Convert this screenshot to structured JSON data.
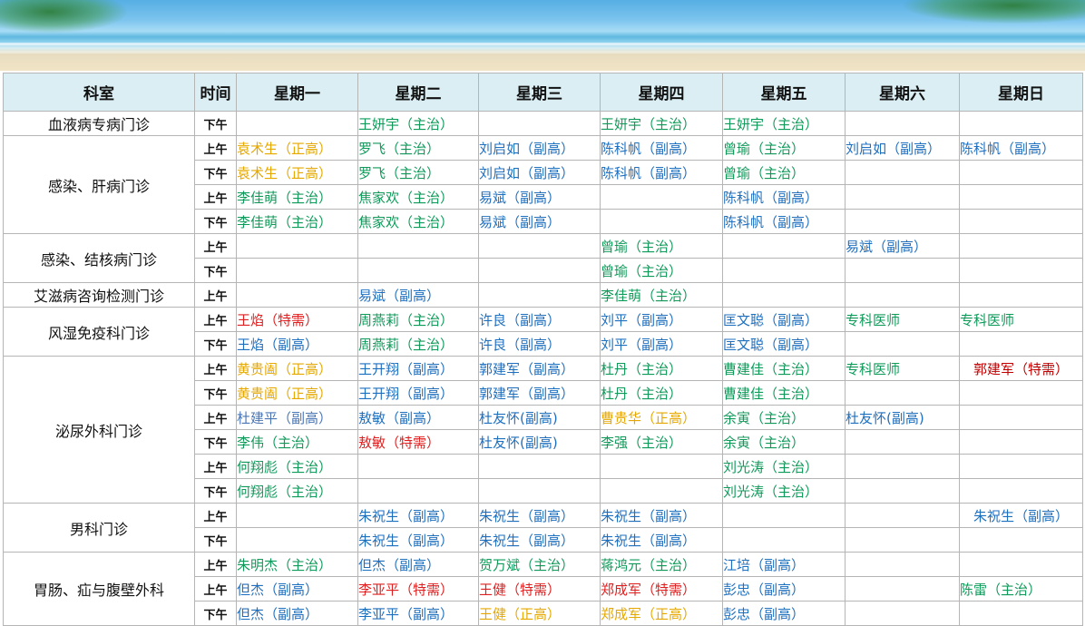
{
  "colors": {
    "blue": "#1f6fbf",
    "green": "#0f9a5a",
    "orange": "#e6a800",
    "red": "#e02020",
    "darkred": "#c00000",
    "steel": "#4a76b5",
    "header_bg": "#daeef3"
  },
  "header": [
    "科室",
    "时间",
    "星期一",
    "星期二",
    "星期三",
    "星期四",
    "星期五",
    "星期六",
    "星期日"
  ],
  "departments": [
    {
      "name": "血液病专病门诊",
      "rows": [
        {
          "time": "下午",
          "cells": [
            null,
            {
              "t": "王妍宇（主治）",
              "c": "green"
            },
            null,
            {
              "t": "王妍宇（主治）",
              "c": "green"
            },
            {
              "t": "王妍宇（主治）",
              "c": "green"
            },
            null,
            null
          ]
        }
      ]
    },
    {
      "name": "感染、肝病门诊",
      "rows": [
        {
          "time": "上午",
          "cells": [
            {
              "t": "袁术生（正高）",
              "c": "orange"
            },
            {
              "t": "罗飞（主治）",
              "c": "green"
            },
            {
              "t": "刘启如（副高）",
              "c": "blue"
            },
            {
              "t": "陈科帆（副高）",
              "c": "blue"
            },
            {
              "t": "曾瑜（主治）",
              "c": "green"
            },
            {
              "t": "刘启如（副高）",
              "c": "blue"
            },
            {
              "t": "陈科帆（副高）",
              "c": "blue"
            }
          ]
        },
        {
          "time": "下午",
          "cells": [
            {
              "t": "袁术生（正高）",
              "c": "orange"
            },
            {
              "t": "罗飞（主治）",
              "c": "green"
            },
            {
              "t": "刘启如（副高）",
              "c": "blue"
            },
            {
              "t": "陈科帆（副高）",
              "c": "blue"
            },
            {
              "t": "曾瑜（主治）",
              "c": "green"
            },
            null,
            null
          ]
        },
        {
          "time": "上午",
          "cells": [
            {
              "t": "李佳萌（主治）",
              "c": "green"
            },
            {
              "t": "焦家欢（主治）",
              "c": "green"
            },
            {
              "t": "易斌（副高）",
              "c": "blue"
            },
            null,
            {
              "t": "陈科帆（副高）",
              "c": "blue"
            },
            null,
            null
          ]
        },
        {
          "time": "下午",
          "cells": [
            {
              "t": "李佳萌（主治）",
              "c": "green"
            },
            {
              "t": "焦家欢（主治）",
              "c": "green"
            },
            {
              "t": "易斌（副高）",
              "c": "blue"
            },
            null,
            {
              "t": "陈科帆（副高）",
              "c": "blue"
            },
            null,
            null
          ]
        }
      ]
    },
    {
      "name": "感染、结核病门诊",
      "rows": [
        {
          "time": "上午",
          "cells": [
            null,
            null,
            null,
            {
              "t": "曾瑜（主治）",
              "c": "green"
            },
            null,
            {
              "t": "易斌（副高）",
              "c": "blue"
            },
            null
          ]
        },
        {
          "time": "下午",
          "cells": [
            null,
            null,
            null,
            {
              "t": "曾瑜（主治）",
              "c": "green"
            },
            null,
            null,
            null
          ]
        }
      ]
    },
    {
      "name": "艾滋病咨询检测门诊",
      "rows": [
        {
          "time": "上午",
          "cells": [
            null,
            {
              "t": "易斌（副高）",
              "c": "blue"
            },
            null,
            {
              "t": "李佳萌（主治）",
              "c": "green"
            },
            null,
            null,
            null
          ]
        }
      ]
    },
    {
      "name": "风湿免疫科门诊",
      "rows": [
        {
          "time": "上午",
          "cells": [
            {
              "t": "王焰（特需）",
              "c": "red"
            },
            {
              "t": "周燕莉（主治）",
              "c": "green"
            },
            {
              "t": "许良（副高）",
              "c": "blue"
            },
            {
              "t": "刘平（副高）",
              "c": "blue"
            },
            {
              "t": "匡文聪（副高）",
              "c": "blue"
            },
            {
              "t": "专科医师",
              "c": "green"
            },
            {
              "t": "专科医师",
              "c": "green"
            }
          ]
        },
        {
          "time": "下午",
          "cells": [
            {
              "t": "王焰（副高）",
              "c": "blue"
            },
            {
              "t": "周燕莉（主治）",
              "c": "green"
            },
            {
              "t": "许良（副高）",
              "c": "blue"
            },
            {
              "t": "刘平（副高）",
              "c": "blue"
            },
            {
              "t": "匡文聪（副高）",
              "c": "blue"
            },
            null,
            null
          ]
        }
      ]
    },
    {
      "name": "泌尿外科门诊",
      "rows": [
        {
          "time": "上午",
          "cells": [
            {
              "t": "黄贵阖（正高）",
              "c": "orange"
            },
            {
              "t": "王开翔（副高）",
              "c": "blue"
            },
            {
              "t": "郭建军（副高）",
              "c": "blue"
            },
            {
              "t": "杜丹（主治）",
              "c": "green"
            },
            {
              "t": "曹建佳（主治）",
              "c": "green"
            },
            {
              "t": "专科医师",
              "c": "green"
            },
            {
              "t": "郭建军（特需）",
              "c": "darkred",
              "center": true
            }
          ]
        },
        {
          "time": "下午",
          "cells": [
            {
              "t": "黄贵阖（正高）",
              "c": "orange"
            },
            {
              "t": "王开翔（副高）",
              "c": "blue"
            },
            {
              "t": "郭建军（副高）",
              "c": "blue"
            },
            {
              "t": "杜丹（主治）",
              "c": "green"
            },
            {
              "t": "曹建佳（主治）",
              "c": "green"
            },
            null,
            null
          ]
        },
        {
          "time": "上午",
          "cells": [
            {
              "t": "杜建平（副高）",
              "c": "steel"
            },
            {
              "t": "敖敏（副高）",
              "c": "blue"
            },
            {
              "t": "杜友怀(副高)",
              "c": "blue"
            },
            {
              "t": "曹贵华（正高）",
              "c": "orange"
            },
            {
              "t": "余寅（主治）",
              "c": "green"
            },
            {
              "t": "杜友怀(副高)",
              "c": "blue"
            },
            null
          ]
        },
        {
          "time": "下午",
          "cells": [
            {
              "t": "李伟（主治）",
              "c": "green"
            },
            {
              "t": "敖敏（特需）",
              "c": "red"
            },
            {
              "t": "杜友怀(副高)",
              "c": "blue"
            },
            {
              "t": "李强（主治）",
              "c": "green"
            },
            {
              "t": "余寅（主治）",
              "c": "green"
            },
            null,
            null
          ]
        },
        {
          "time": "上午",
          "cells": [
            {
              "t": "何翔彪（主治）",
              "c": "green"
            },
            null,
            null,
            null,
            {
              "t": "刘光涛（主治）",
              "c": "green"
            },
            null,
            null
          ]
        },
        {
          "time": "下午",
          "cells": [
            {
              "t": "何翔彪（主治）",
              "c": "green"
            },
            null,
            null,
            null,
            {
              "t": "刘光涛（主治）",
              "c": "green"
            },
            null,
            null
          ]
        }
      ]
    },
    {
      "name": "男科门诊",
      "rows": [
        {
          "time": "上午",
          "cells": [
            null,
            {
              "t": "朱祝生（副高）",
              "c": "blue"
            },
            {
              "t": "朱祝生（副高）",
              "c": "blue"
            },
            {
              "t": "朱祝生（副高）",
              "c": "blue"
            },
            null,
            null,
            {
              "t": "朱祝生（副高）",
              "c": "blue",
              "center": true
            }
          ]
        },
        {
          "time": "下午",
          "cells": [
            null,
            {
              "t": "朱祝生（副高）",
              "c": "blue"
            },
            {
              "t": "朱祝生（副高）",
              "c": "blue"
            },
            {
              "t": "朱祝生（副高）",
              "c": "blue"
            },
            null,
            null,
            null
          ]
        }
      ]
    },
    {
      "name": "胃肠、疝与腹壁外科",
      "rows": [
        {
          "time": "上午",
          "cells": [
            {
              "t": "朱明杰（主治）",
              "c": "green"
            },
            {
              "t": "但杰（副高）",
              "c": "blue"
            },
            {
              "t": "贺万斌（主治）",
              "c": "green"
            },
            {
              "t": "蒋鸿元（主治）",
              "c": "green"
            },
            {
              "t": "江培（副高）",
              "c": "blue"
            },
            null,
            null
          ]
        },
        {
          "time": "上午",
          "cells": [
            {
              "t": "但杰（副高）",
              "c": "blue"
            },
            {
              "t": "李亚平（特需）",
              "c": "red"
            },
            {
              "t": "王健（特需）",
              "c": "red"
            },
            {
              "t": "郑成军（特需）",
              "c": "red"
            },
            {
              "t": "彭忠（副高）",
              "c": "blue"
            },
            null,
            {
              "t": "陈雷（主治）",
              "c": "green"
            }
          ]
        },
        {
          "time": "下午",
          "cells": [
            {
              "t": "但杰（副高）",
              "c": "blue"
            },
            {
              "t": "李亚平（副高）",
              "c": "blue"
            },
            {
              "t": "王健（正高）",
              "c": "orange"
            },
            {
              "t": "郑成军（正高）",
              "c": "orange"
            },
            {
              "t": "彭忠（副高）",
              "c": "blue"
            },
            null,
            null
          ]
        }
      ]
    }
  ]
}
